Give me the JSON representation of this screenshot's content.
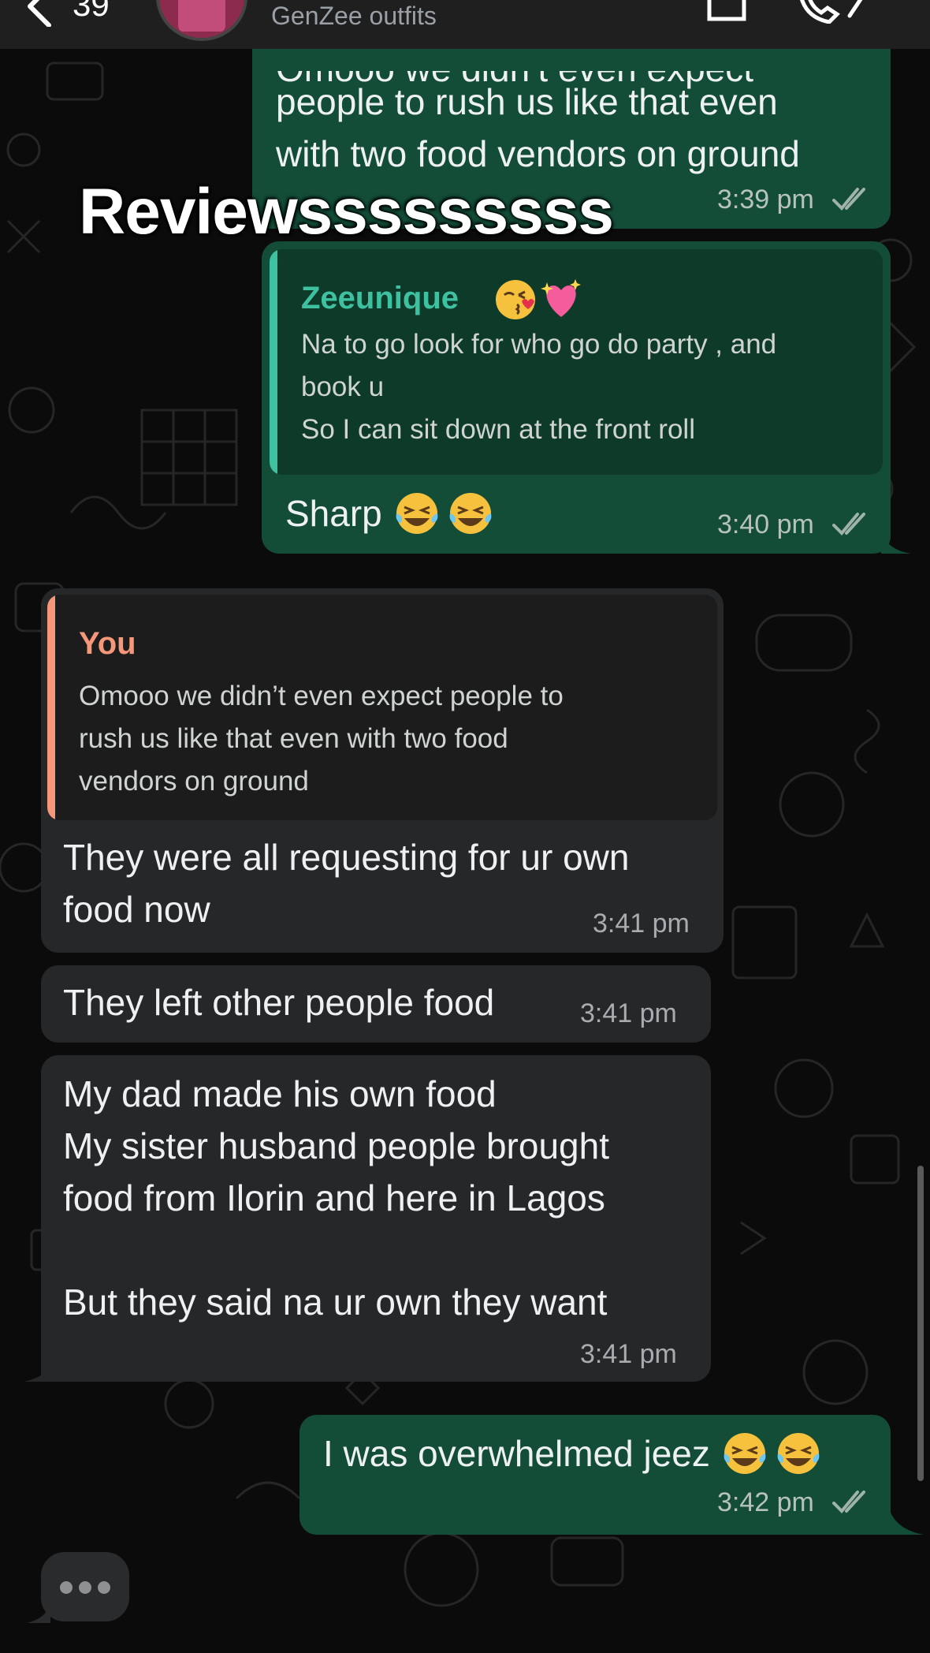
{
  "header": {
    "back_count": "39",
    "group_subtitle": "GenZee outfits"
  },
  "overlay": {
    "caption": "Reviewsssssssss"
  },
  "messages": [
    {
      "direction": "outgoing",
      "text_lines": [
        "Omooo we didn’t even expect",
        "people to rush us like that even",
        "with two food vendors on ground"
      ],
      "time": "3:39 pm",
      "status": "read-double-tick"
    },
    {
      "direction": "outgoing",
      "quote": {
        "author": "Zeeunique",
        "text": "Na to go look for who go do party , and\nbook u\nSo I can sit down at the front roll"
      },
      "text": "Sharp",
      "emojis": [
        "tears-of-joy",
        "tears-of-joy"
      ],
      "time": "3:40 pm",
      "status": "read-double-tick"
    },
    {
      "direction": "incoming",
      "quote": {
        "author": "You",
        "text": "Omooo we didn’t even expect people to\nrush us like that even with two food\nvendors on ground"
      },
      "text": "They were all requesting for ur own\nfood now",
      "time": "3:41 pm"
    },
    {
      "direction": "incoming",
      "text": "They left other people food",
      "time": "3:41 pm"
    },
    {
      "direction": "incoming",
      "text": "My dad made his own food\nMy sister husband people brought\nfood from Ilorin and here in Lagos\n\nBut they said na ur own they want",
      "time": "3:41 pm"
    },
    {
      "direction": "outgoing",
      "text": "I was overwhelmed jeez",
      "emojis": [
        "tears-of-joy",
        "tears-of-joy"
      ],
      "time": "3:42 pm",
      "status": "read-double-tick"
    }
  ],
  "colors": {
    "outgoing_bubble": "#134d37",
    "incoming_bubble": "#262729",
    "quote_author_out": "#3ec1a0",
    "quote_author_in": "#f7977a"
  }
}
